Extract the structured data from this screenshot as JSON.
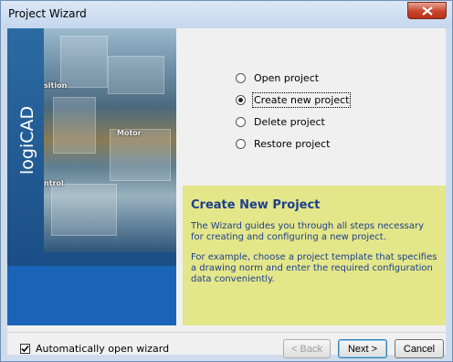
{
  "window": {
    "title": "Project Wizard"
  },
  "banner": {
    "logo_text": "logiCAD",
    "photo_labels": [
      "sition",
      "Motor",
      "ntrol"
    ]
  },
  "options": [
    {
      "label": "Open project",
      "selected": false
    },
    {
      "label": "Create new project",
      "selected": true
    },
    {
      "label": "Delete project",
      "selected": false
    },
    {
      "label": "Restore project",
      "selected": false
    }
  ],
  "info": {
    "title": "Create New Project",
    "para1": "The Wizard guides you through all steps necessary for creating and configuring a new project.",
    "para2": "For example, choose a project template that specifies a drawing norm and enter the required configuration data conveniently."
  },
  "footer": {
    "auto_open_label": "Automatically open wizard",
    "auto_open_checked": true,
    "back_label": "< Back",
    "next_label": "Next >",
    "cancel_label": "Cancel"
  },
  "colors": {
    "info_bg": "#e4e68a",
    "info_text": "#1b3f8b",
    "banner_blue": "#1a64b8",
    "close_red": "#c8452c"
  }
}
